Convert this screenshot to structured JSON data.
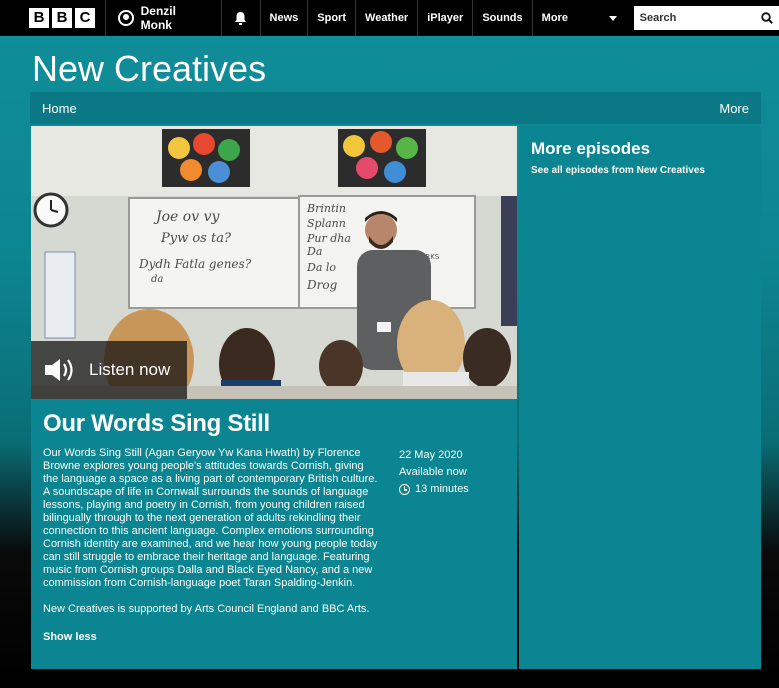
{
  "bbc": {
    "logo_letters": [
      "B",
      "B",
      "C"
    ]
  },
  "account": {
    "name": "Denzil Monk"
  },
  "nav": {
    "items": [
      "News",
      "Sport",
      "Weather",
      "iPlayer",
      "Sounds"
    ],
    "more_label": "More",
    "search_placeholder": "Search"
  },
  "brand": {
    "title": "New Creatives"
  },
  "subnav": {
    "home_label": "Home",
    "more_label": "More"
  },
  "episode": {
    "listen_label": "Listen now",
    "title": "Our Words Sing Still",
    "description": "Our Words Sing Still (Agan Geryow Yw Kana Hwath) by Florence Browne explores young people's attitudes towards Cornish, giving the language a space as a living part of contemporary British culture. A soundscape of life in Cornwall surrounds the sounds of language lessons, playing and poetry in Cornish, from young children raised bilingually through to the next generation of adults rekindling their connection to this ancient language. Complex emotions surrounding Cornish identity are examined, and we hear how young people today can still struggle to embrace their heritage and language. Featuring music from Cornish groups Dalla and Black Eyed Nancy, and a new commission from Cornish-language poet Taran Spalding-Jenkin.",
    "support_note": "New Creatives is supported by Arts Council England and BBC Arts.",
    "show_less_label": "Show less",
    "date": "22 May 2020",
    "availability": "Available now",
    "duration": "13 minutes"
  },
  "hero_image": {
    "whiteboard_left": [
      "Joe ov vy",
      "Pyw os ta?",
      "Dydh   Fatla genes?",
      "da"
    ],
    "whiteboard_right": [
      "Brintin",
      "Splann",
      "Pur dha",
      "Da",
      "Da lo",
      "Drog"
    ],
    "whiteboard_small": "WORKS"
  },
  "sidebar": {
    "title": "More episodes",
    "link_label": "See all episodes from New Creatives"
  },
  "colors": {
    "teal": "#0b8591",
    "black": "#000000"
  },
  "icons": [
    "user-icon",
    "bell-icon",
    "chevron-down-icon",
    "search-icon",
    "speaker-icon",
    "clock-icon"
  ]
}
